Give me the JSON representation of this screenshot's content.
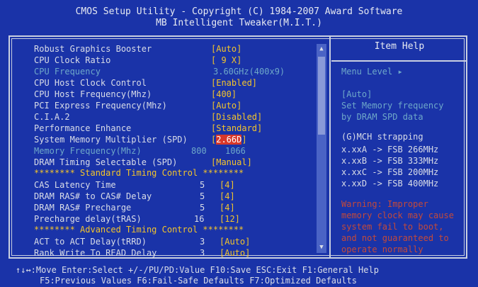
{
  "header": {
    "line1": "CMOS Setup Utility - Copyright (C) 1984-2007 Award Software",
    "line2": "MB Intelligent Tweaker(M.I.T.)"
  },
  "settings": [
    {
      "label": "Robust Graphics Booster",
      "value": "[Auto]"
    },
    {
      "label": "CPU Clock Ratio",
      "value": "[ 9 X]"
    },
    {
      "label": "CPU Frequency",
      "value": "3.60GHz(400x9)"
    },
    {
      "label": "CPU Host Clock Control",
      "value": "[Enabled]"
    },
    {
      "label": "CPU Host Frequency(Mhz)",
      "value": "[400]"
    },
    {
      "label": "PCI Express Frequency(Mhz)",
      "value": "[Auto]"
    },
    {
      "label": "C.I.A.2",
      "value": "[Disabled]"
    },
    {
      "label": "Performance Enhance",
      "value": "[Standard]"
    },
    {
      "label": "System Memory Multiplier (SPD)",
      "value": "[2.66D]"
    },
    {
      "label": "Memory Frequency(Mhz)",
      "num": "800",
      "value": "1066"
    },
    {
      "label": "DRAM Timing Selectable  (SPD)",
      "value": "[Manual]"
    },
    {
      "header": "******** Standard Timing Control ********"
    },
    {
      "label": "CAS Latency Time",
      "num": "5",
      "value": "[4]"
    },
    {
      "label": "DRAM RAS# to CAS# Delay",
      "num": "5",
      "value": "[4]"
    },
    {
      "label": "DRAM RAS# Precharge",
      "num": "5",
      "value": "[4]"
    },
    {
      "label": "Precharge delay(tRAS)",
      "num": "16",
      "value": "[12]"
    },
    {
      "header": "******** Advanced Timing Control ********"
    },
    {
      "label": "ACT to ACT Delay(tRRD)",
      "num": "3",
      "value": "[Auto]"
    },
    {
      "label": "Rank Write To READ Delay",
      "num": "3",
      "value": "[Auto]"
    }
  ],
  "help": {
    "title": "Item Help",
    "menu_level": "Menu Level  ▸",
    "desc1": "[Auto]",
    "desc2": "Set Memory frequency",
    "desc3": "by DRAM SPD data",
    "strap_title": "(G)MCH strapping",
    "strap": [
      "x.xxA -> FSB 266MHz",
      "x.xxB -> FSB 333MHz",
      "x.xxC -> FSB 200MHz",
      "x.xxD -> FSB 400MHz"
    ],
    "warning": [
      "Warning: Improper",
      "memory clock may cause",
      "system fail to boot,",
      "and not guaranteed to",
      "operate normally"
    ]
  },
  "footer": {
    "line1": "↑↓↔:Move  Enter:Select  +/-/PU/PD:Value  F10:Save  ESC:Exit  F1:General Help",
    "line2": "F5:Previous Values  F6:Fail-Safe Defaults  F7:Optimized Defaults"
  },
  "colors": {
    "background": "#1a33a8",
    "value": "#f3c42b",
    "disabled": "#6ea8c9",
    "selected": "#d8382b",
    "warning": "#c44a3a"
  }
}
